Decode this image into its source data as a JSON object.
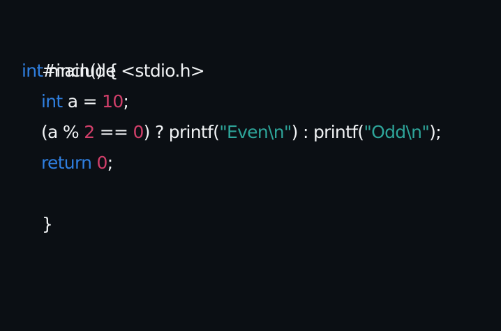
{
  "code": {
    "line1": {
      "text": "#include <stdio.h>"
    },
    "line2": {
      "kw": "int",
      "rest": " main() {"
    },
    "line3": {
      "kw": "int",
      "mid": " a = ",
      "num": "10",
      "end": ";"
    },
    "line4": {
      "p1": "(a % ",
      "n1": "2",
      "p2": " == ",
      "n2": "0",
      "p3": ") ? printf(",
      "s1": "\"Even\\n\"",
      "p4": ") : printf(",
      "s2": "\"Odd\\n\"",
      "p5": ");"
    },
    "line5": {
      "kw": "return",
      "space": " ",
      "num": "0",
      "end": ";"
    },
    "line6": {
      "text": "}"
    }
  },
  "colors": {
    "background": "#0b0f14",
    "text": "#f1f3f5",
    "keyword": "#2f7fe0",
    "number": "#d23f6a",
    "string": "#2ea59a"
  }
}
